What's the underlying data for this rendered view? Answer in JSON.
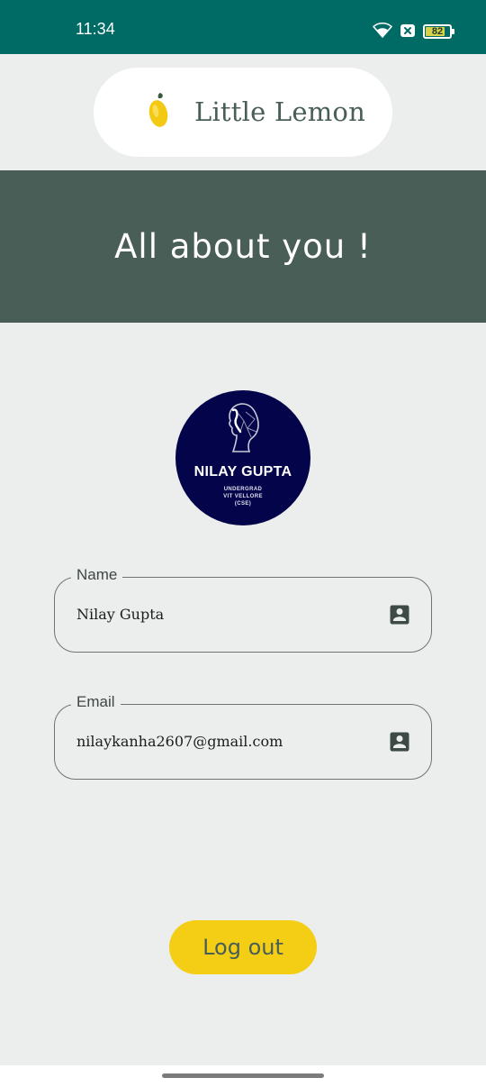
{
  "status_bar": {
    "time": "11:34",
    "battery_level": "82",
    "battery_fraction": 0.82,
    "icons": [
      "wifi-icon",
      "sim-disabled-icon",
      "battery-icon"
    ]
  },
  "header": {
    "logo_text": "Little Lemon",
    "logo_icon": "lemon-icon"
  },
  "banner": {
    "title": "All about you !"
  },
  "profile": {
    "avatar_name": "NILAY GUPTA",
    "avatar_sub": [
      "UNDERGRAD",
      "VIT VELLORE",
      "(CSE)"
    ]
  },
  "fields": {
    "name": {
      "label": "Name",
      "value": "Nilay Gupta",
      "icon": "account-box-icon"
    },
    "email": {
      "label": "Email",
      "value": "nilaykanha2607@gmail.com",
      "icon": "account-box-icon"
    }
  },
  "actions": {
    "logout_label": "Log out"
  },
  "colors": {
    "status_bar": "#006b65",
    "primary": "#495e57",
    "accent": "#f4ce14",
    "background": "#eceeed",
    "avatar_bg": "#04044a"
  }
}
